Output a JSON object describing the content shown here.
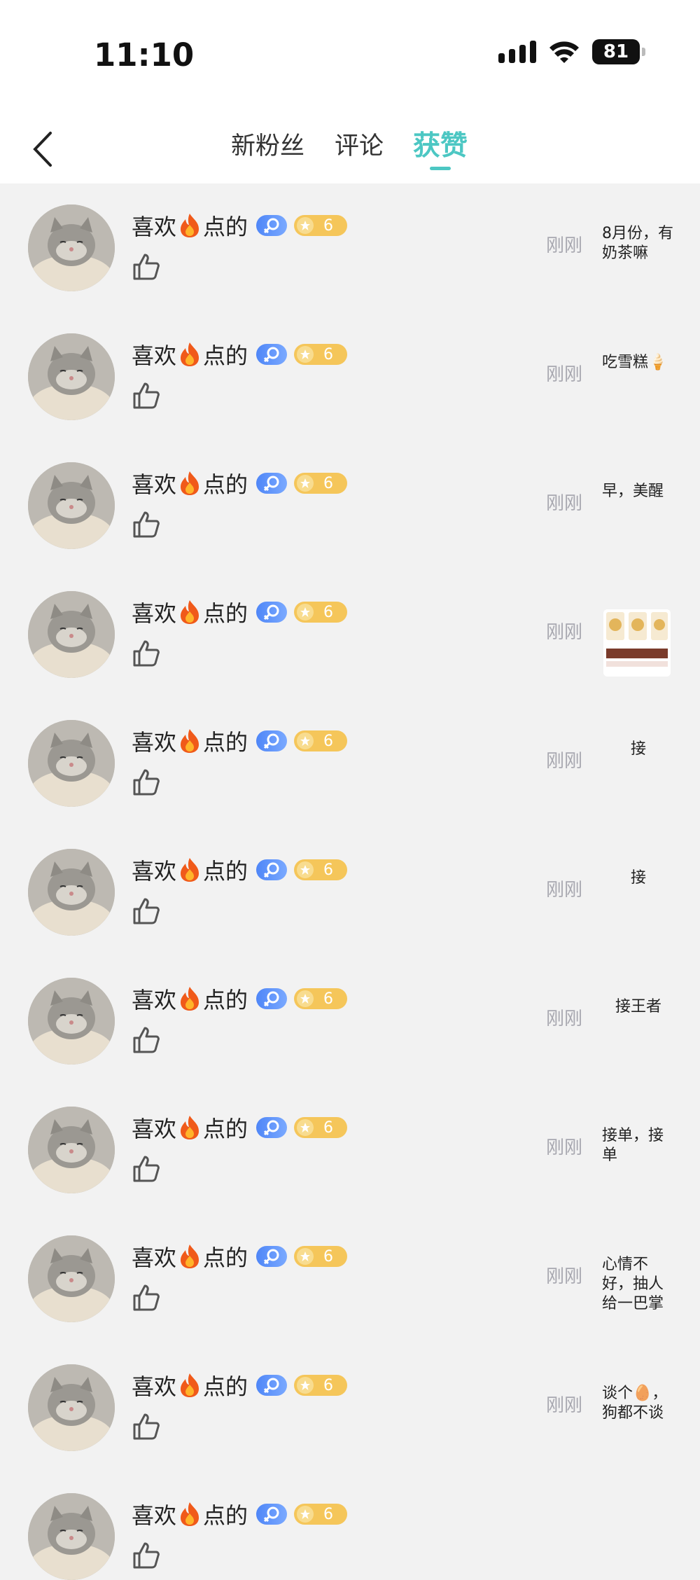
{
  "status": {
    "time": "11:10",
    "battery": "81"
  },
  "header": {
    "tabs": [
      {
        "label": "新粉丝"
      },
      {
        "label": "评论"
      },
      {
        "label": "获赞"
      }
    ]
  },
  "rows": [
    {
      "name_prefix": "喜欢",
      "name_suffix": "点的",
      "level": "6",
      "time": "刚刚",
      "comment": "8月份，有奶茶嘛"
    },
    {
      "name_prefix": "喜欢",
      "name_suffix": "点的",
      "level": "6",
      "time": "刚刚",
      "comment": "吃雪糕🍦"
    },
    {
      "name_prefix": "喜欢",
      "name_suffix": "点的",
      "level": "6",
      "time": "刚刚",
      "comment": "早，美醒"
    },
    {
      "name_prefix": "喜欢",
      "name_suffix": "点的",
      "level": "6",
      "time": "刚刚",
      "comment": ""
    },
    {
      "name_prefix": "喜欢",
      "name_suffix": "点的",
      "level": "6",
      "time": "刚刚",
      "comment": "接"
    },
    {
      "name_prefix": "喜欢",
      "name_suffix": "点的",
      "level": "6",
      "time": "刚刚",
      "comment": "接"
    },
    {
      "name_prefix": "喜欢",
      "name_suffix": "点的",
      "level": "6",
      "time": "刚刚",
      "comment": "接王者"
    },
    {
      "name_prefix": "喜欢",
      "name_suffix": "点的",
      "level": "6",
      "time": "刚刚",
      "comment": "接单，接单"
    },
    {
      "name_prefix": "喜欢",
      "name_suffix": "点的",
      "level": "6",
      "time": "刚刚",
      "comment": "心情不好，抽人给一巴掌"
    },
    {
      "name_prefix": "喜欢",
      "name_suffix": "点的",
      "level": "6",
      "time": "刚刚",
      "comment": "谈个🥚，狗都不谈"
    },
    {
      "name_prefix": "喜欢",
      "name_suffix": "点的",
      "level": "6",
      "time": "",
      "comment": ""
    }
  ],
  "colors": {
    "accent": "#4cc7c3",
    "background": "#f2f2f2"
  }
}
